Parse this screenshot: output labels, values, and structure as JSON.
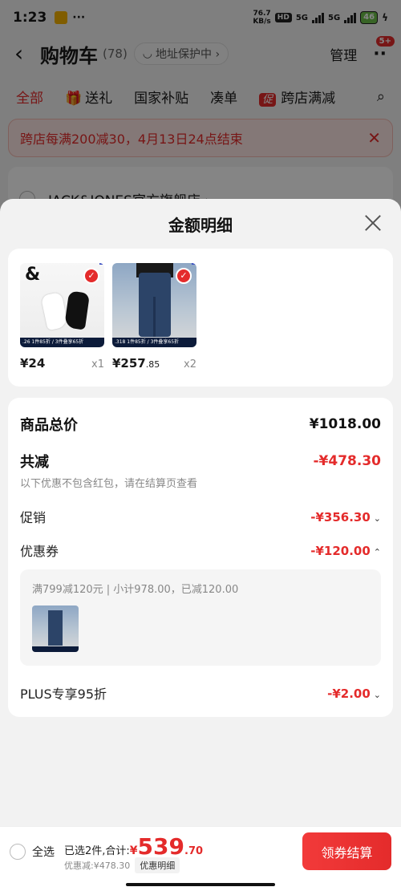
{
  "status_bar": {
    "time": "1:23",
    "dots": "···",
    "net_speed_value": "76.7",
    "net_speed_unit": "KB/s",
    "hd_label": "HD",
    "signal_1": "5G",
    "signal_2": "5G",
    "battery": "46"
  },
  "cart_header": {
    "title": "购物车",
    "count": "(78)",
    "address_pill": "地址保护中 ›",
    "manage_label": "管理",
    "more_badge": "5+"
  },
  "tabs": [
    {
      "label": "全部"
    },
    {
      "label": "送礼"
    },
    {
      "label": "国家补贴"
    },
    {
      "label": "凑单"
    },
    {
      "label": "跨店满减",
      "icon_label": "促"
    }
  ],
  "promo_banner": {
    "text": "跨店每满200减30，4月13日24点结束"
  },
  "store": {
    "name": "JACK&JONES官方旗舰店 ›"
  },
  "sheet": {
    "title": "金额明细",
    "goods": [
      {
        "name": "socks",
        "price_int": "¥24",
        "price_dec": "",
        "qty": "x1",
        "foot": "1件85折 / 3件叠享65折",
        "foot_price": ".26",
        "brand": "&"
      },
      {
        "name": "jeans",
        "price_int": "¥257",
        "price_dec": ".85",
        "qty": "x2",
        "foot": "1件85折 / 3件叠享65折",
        "foot_price": ".318",
        "brand": ""
      }
    ],
    "total_label": "商品总价",
    "total_value": "¥1018.00",
    "discount_label": "共减",
    "discount_value": "-¥478.30",
    "discount_note": "以下优惠不包含红包，请在结算页查看",
    "promo_label": "促销",
    "promo_value": "-¥356.30",
    "coupon_label": "优惠券",
    "coupon_value": "-¥120.00",
    "coupon_desc": "满799减120元 | 小计978.00，已减120.00",
    "plus_label": "PLUS专享95折",
    "plus_value": "-¥2.00"
  },
  "bottom_bar": {
    "select_all": "全选",
    "selected_prefix": "已选2件,合计:",
    "currency": "¥",
    "sum_int": "539",
    "sum_dec": ".70",
    "discount_text": "优惠减:¥478.30",
    "detail_button": "优惠明细",
    "checkout_button": "领券结算"
  },
  "colors": {
    "accent_red": "#e42b2b",
    "banner_bg": "#fde7e4"
  }
}
